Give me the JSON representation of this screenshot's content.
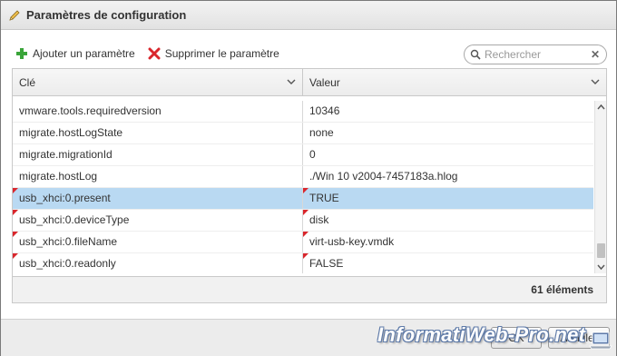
{
  "dialog": {
    "title": "Paramètres de configuration",
    "title_icon": "pencil-icon"
  },
  "toolbar": {
    "add_label": "Ajouter un paramètre",
    "add_icon": "plus-icon",
    "add_color": "#3aa53a",
    "remove_label": "Supprimer le paramètre",
    "remove_icon": "x-icon",
    "remove_color": "#d9262c"
  },
  "search": {
    "placeholder": "Rechercher",
    "value": ""
  },
  "grid": {
    "columns": [
      "Clé",
      "Valeur"
    ],
    "rows": [
      {
        "key": "vmware.tools.requiredversion",
        "value": "10346",
        "modified": false,
        "selected": false
      },
      {
        "key": "migrate.hostLogState",
        "value": "none",
        "modified": false,
        "selected": false
      },
      {
        "key": "migrate.migrationId",
        "value": "0",
        "modified": false,
        "selected": false
      },
      {
        "key": "migrate.hostLog",
        "value": "./Win 10 v2004-7457183a.hlog",
        "modified": false,
        "selected": false
      },
      {
        "key": "usb_xhci:0.present",
        "value": "TRUE",
        "modified": true,
        "selected": true
      },
      {
        "key": "usb_xhci:0.deviceType",
        "value": "disk",
        "modified": true,
        "selected": false
      },
      {
        "key": "usb_xhci:0.fileName",
        "value": "virt-usb-key.vmdk",
        "modified": true,
        "selected": false
      },
      {
        "key": "usb_xhci:0.readonly",
        "value": "FALSE",
        "modified": true,
        "selected": false
      }
    ],
    "count_label": "61 éléments",
    "selected_color": "#b9d9f2",
    "modified_flag_color": "#d9262c"
  },
  "buttons": {
    "ok_label": "OK",
    "cancel_label": "Annuler"
  },
  "watermark": {
    "text": "InformatiWeb-Pro.net"
  }
}
